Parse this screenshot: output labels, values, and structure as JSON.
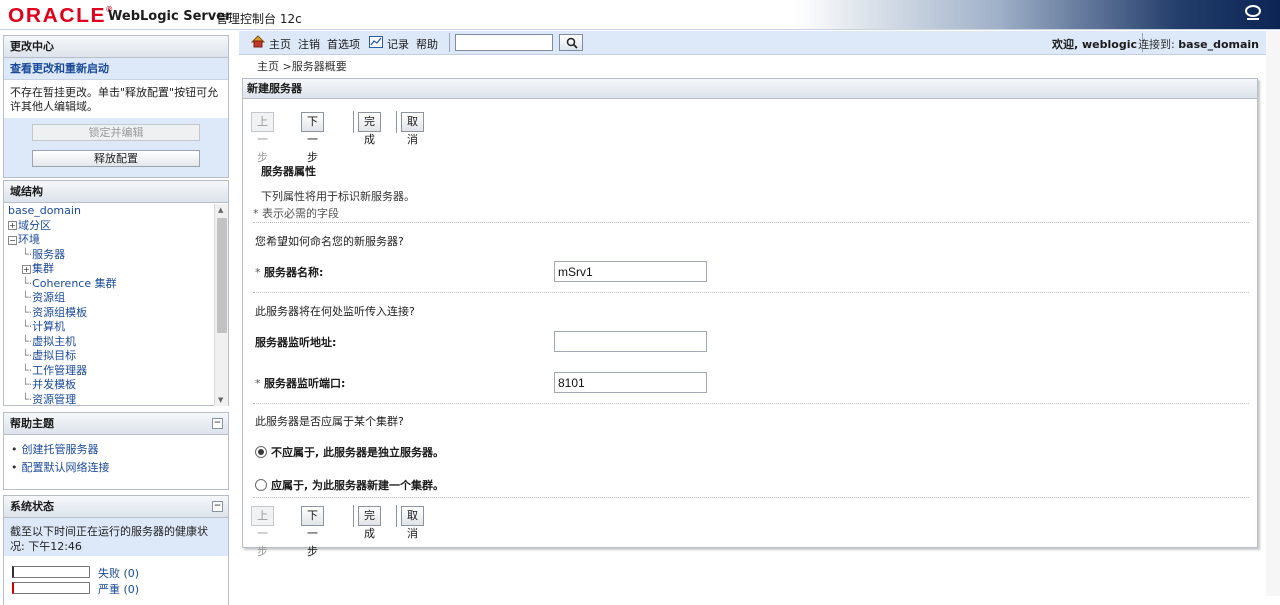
{
  "banner": {
    "brand": "ORACLE",
    "brand_reg": "®",
    "product": "WebLogic Server",
    "product_sub": "管理控制台 12c"
  },
  "change_center": {
    "title": "更改中心",
    "view_changes": "查看更改和重新启动",
    "note": "不存在暂挂更改。单击\"释放配置\"按钮可允许其他人编辑域。",
    "lock_edit": "锁定并编辑",
    "release_config": "释放配置"
  },
  "domain_structure": {
    "title": "域结构",
    "root": "base_domain",
    "nodes": [
      {
        "label": "域分区",
        "exp": "⊞"
      },
      {
        "label": "环境",
        "exp": "⊟"
      },
      {
        "label": "服务器"
      },
      {
        "label": "集群",
        "exp": "⊞"
      },
      {
        "label": "Coherence 集群"
      },
      {
        "label": "资源组"
      },
      {
        "label": "资源组模板"
      },
      {
        "label": "计算机"
      },
      {
        "label": "虚拟主机"
      },
      {
        "label": "虚拟目标"
      },
      {
        "label": "工作管理器"
      },
      {
        "label": "并发模板"
      },
      {
        "label": "资源管理"
      }
    ]
  },
  "help_topics": {
    "title": "帮助主题",
    "items": [
      "创建托管服务器",
      "配置默认网络连接"
    ]
  },
  "system_status": {
    "title": "系统状态",
    "text": "截至以下时间正在运行的服务器的健康状况:  下午12:46",
    "failed": "失败 (0)",
    "critical": "严重 (0)"
  },
  "topnav": {
    "home": "主页",
    "logout": "注销",
    "preferences": "首选项",
    "record": "记录",
    "help": "帮助",
    "search_value": "",
    "welcome": "欢迎, weblogic",
    "connected_label": "连接到: ",
    "connected_domain": "base_domain"
  },
  "breadcrumb": {
    "home": "主页",
    "sep": " >",
    "current": "服务器概要"
  },
  "main": {
    "title": "新建服务器",
    "buttons": {
      "back": "上一步",
      "next": "下一步",
      "finish": "完成",
      "cancel": "取消"
    },
    "section_title": "服务器属性",
    "section_desc": "下列属性将用于标识新服务器。",
    "required_note": "* 表示必需的字段",
    "q_name": "您希望如何命名您的新服务器?",
    "name_label": "服务器名称:",
    "name_value": "mSrv1",
    "q_listen": "此服务器将在何处监听传入连接?",
    "addr_label": "服务器监听地址:",
    "addr_value": "",
    "port_label": "服务器监听端口:",
    "port_value": "8101",
    "q_cluster": "此服务器是否应属于某个集群?",
    "radio_no": "不应属于, 此服务器是独立服务器。",
    "radio_yes": "应属于, 为此服务器新建一个集群。",
    "req_mark": "* "
  },
  "colors": {
    "brand_red": "#e0001b",
    "link_blue": "#1b4a9a",
    "nav_bg": "#dde8f8",
    "critical_red": "#d40000"
  }
}
